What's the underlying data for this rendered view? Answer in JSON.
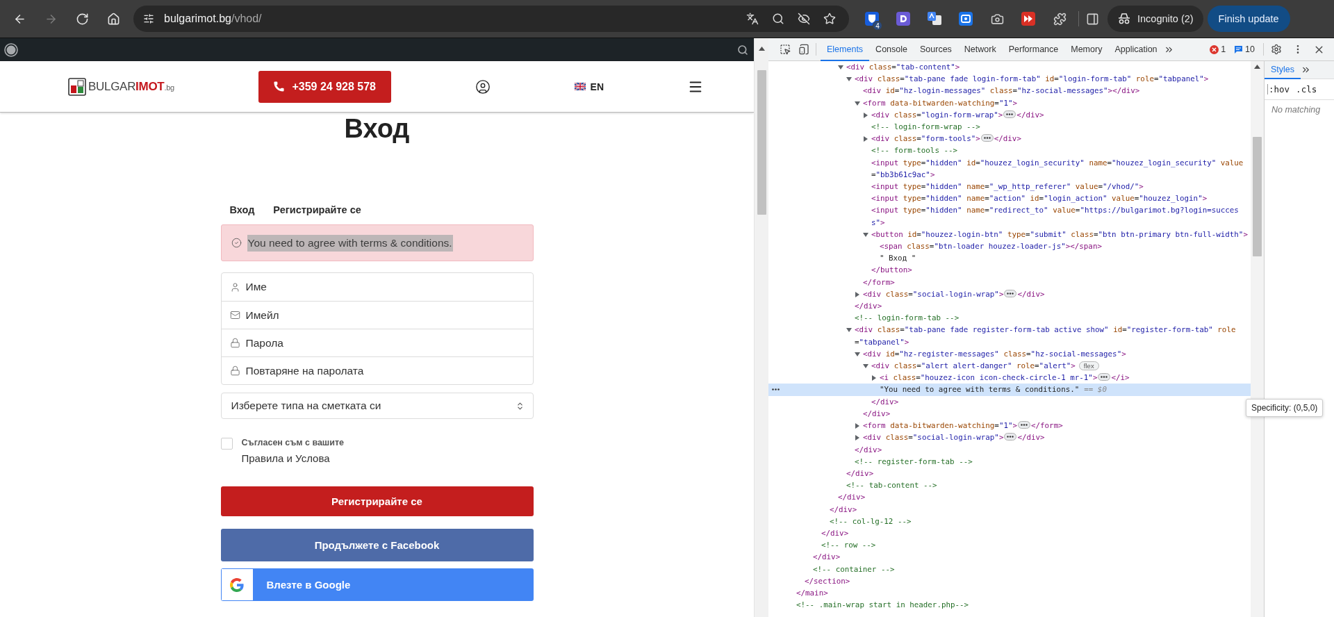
{
  "browser": {
    "forward_disabled": true,
    "url_host": "bulgarimot.bg",
    "url_path": "/vhod/",
    "extension_badge": "4",
    "profile_label": "Incognito (2)",
    "update_button": "Finish update"
  },
  "page": {
    "logo": {
      "light": "BULGAR",
      "bold": "IMOT",
      "suffix": ".bg"
    },
    "phone": "+359 24 928 578",
    "language": "EN",
    "heading": "Вход",
    "tabs": [
      {
        "label": "Вход"
      },
      {
        "label": "Регистрирайте се"
      }
    ],
    "alert": {
      "text": "You need to agree with terms & conditions.",
      "highlighted": true
    },
    "fields": [
      {
        "kind": "person",
        "placeholder": "Име"
      },
      {
        "kind": "mail",
        "placeholder": "Имейл"
      },
      {
        "kind": "lock",
        "placeholder": "Парола"
      },
      {
        "kind": "lock",
        "placeholder": "Повтаряне на паролата"
      }
    ],
    "account_type": {
      "label": "Изберете типа на сметката си"
    },
    "terms": {
      "checked": false,
      "label": "Съгласен съм с вашите",
      "link": "Правила и Услова"
    },
    "buttons": [
      {
        "kind": "primary",
        "label": "Регистрирайте се"
      },
      {
        "kind": "facebook",
        "label": "Продължете с Facebook"
      },
      {
        "kind": "google",
        "label": "Влезте в Google"
      }
    ]
  },
  "devtools": {
    "tabs": [
      {
        "label": "Elements",
        "selected": true
      },
      {
        "label": "Console",
        "selected": false
      },
      {
        "label": "Sources",
        "selected": false
      },
      {
        "label": "Network",
        "selected": false
      },
      {
        "label": "Performance",
        "selected": false
      },
      {
        "label": "Memory",
        "selected": false
      },
      {
        "label": "Application",
        "selected": false
      }
    ],
    "errors": "1",
    "messages": "10",
    "dom_tree": [
      {
        "kind": "element",
        "close": "</main>",
        "selected": false,
        "children": [
          {
            "kind": "element",
            "close": "</section>",
            "selected": false,
            "children": [
              {
                "kind": "element",
                "close": "</div>",
                "selected": false,
                "children": [
                  {
                    "kind": "element",
                    "close": "</div>",
                    "selected": false,
                    "children": [
                      {
                        "kind": "element",
                        "close": "</div>",
                        "selected": false,
                        "children": [
                          {
                            "kind": "element",
                            "close": "</div>",
                            "selected": false,
                            "children": [
                              {
                                "kind": "element",
                                "open": "<div class=\"tab-content\">",
                                "close": "</div>",
                                "expanded": true,
                                "selected": false,
                                "children": [
                                  {
                                    "kind": "element",
                                    "open": "<div class=\"tab-pane fade login-form-tab\" id=\"login-form-tab\" role=\"tabpanel\">",
                                    "close": "</div>",
                                    "expanded": true,
                                    "selected": false,
                                    "children": [
                                      {
                                        "kind": "element",
                                        "open": "<div id=\"hz-login-messages\" class=\"hz-social-messages\"></div>",
                                        "selected": false
                                      },
                                      {
                                        "kind": "element",
                                        "open": "<form data-bitwarden-watching=\"1\">",
                                        "close": "</form>",
                                        "expanded": true,
                                        "selected": false,
                                        "children": [
                                          {
                                            "kind": "element",
                                            "open": "<div class=\"login-form-wrap\">",
                                            "close": "</div>",
                                            "expanded": false,
                                            "selected": false
                                          },
                                          {
                                            "kind": "comment",
                                            "text": "<!-- login-form-wrap -->",
                                            "selected": false
                                          },
                                          {
                                            "kind": "element",
                                            "open": "<div class=\"form-tools\">",
                                            "close": "</div>",
                                            "expanded": false,
                                            "selected": false
                                          },
                                          {
                                            "kind": "comment",
                                            "text": "<!-- form-tools -->",
                                            "selected": false
                                          },
                                          {
                                            "kind": "element",
                                            "open": "<input type=\"hidden\" id=\"houzez_login_security\" name=\"houzez_login_security\" value=\"bb3b61c9ac\">",
                                            "selected": false
                                          },
                                          {
                                            "kind": "element",
                                            "open": "<input type=\"hidden\" name=\"_wp_http_referer\" value=\"/vhod/\">",
                                            "selected": false
                                          },
                                          {
                                            "kind": "element",
                                            "open": "<input type=\"hidden\" name=\"action\" id=\"login_action\" value=\"houzez_login\">",
                                            "selected": false
                                          },
                                          {
                                            "kind": "element",
                                            "open": "<input type=\"hidden\" name=\"redirect_to\" value=\"https://bulgarimot.bg?login=success\">",
                                            "selected": false
                                          },
                                          {
                                            "kind": "element",
                                            "open": "<button id=\"houzez-login-btn\" type=\"submit\" class=\"btn btn-primary btn-full-width\">",
                                            "close": "</button>",
                                            "expanded": true,
                                            "selected": false,
                                            "children": [
                                              {
                                                "kind": "element",
                                                "open": "<span class=\"btn-loader houzez-loader-js\"></span>",
                                                "selected": false
                                              },
                                              {
                                                "kind": "text",
                                                "text": "\" Вход \"",
                                                "selected": false
                                              }
                                            ]
                                          }
                                        ]
                                      },
                                      {
                                        "kind": "element",
                                        "open": "<div class=\"social-login-wrap\">",
                                        "close": "</div>",
                                        "expanded": false,
                                        "selected": false
                                      }
                                    ]
                                  },
                                  {
                                    "kind": "comment",
                                    "text": "<!-- login-form-tab -->",
                                    "selected": false
                                  },
                                  {
                                    "kind": "element",
                                    "open": "<div class=\"tab-pane fade register-form-tab active show\" id=\"register-form-tab\" role=\"tabpanel\">",
                                    "close": "</div>",
                                    "expanded": true,
                                    "selected": false,
                                    "children": [
                                      {
                                        "kind": "element",
                                        "open": "<div id=\"hz-register-messages\" class=\"hz-social-messages\">",
                                        "close": "</div>",
                                        "expanded": true,
                                        "selected": false,
                                        "children": [
                                          {
                                            "kind": "element",
                                            "open": "<div class=\"alert alert-danger\" role=\"alert\">",
                                            "badge": "flex",
                                            "close": "</div>",
                                            "expanded": true,
                                            "selected": false,
                                            "children": [
                                              {
                                                "kind": "element",
                                                "open": "<i class=\"houzez-icon icon-check-circle-1 mr-1\">",
                                                "close": "</i>",
                                                "expanded": false,
                                                "selected": false
                                              },
                                              {
                                                "kind": "text",
                                                "text": "\"You need to agree with terms & conditions.\"",
                                                "console_ref": "== $0",
                                                "selected": true
                                              }
                                            ]
                                          }
                                        ]
                                      },
                                      {
                                        "kind": "element",
                                        "open": "<form data-bitwarden-watching=\"1\">",
                                        "close": "</form>",
                                        "expanded": false,
                                        "selected": false
                                      },
                                      {
                                        "kind": "element",
                                        "open": "<div class=\"social-login-wrap\">",
                                        "close": "</div>",
                                        "expanded": false,
                                        "selected": false
                                      }
                                    ]
                                  },
                                  {
                                    "kind": "comment",
                                    "text": "<!-- register-form-tab -->",
                                    "selected": false
                                  }
                                ]
                              },
                              {
                                "kind": "comment",
                                "text": "<!-- tab-content -->",
                                "selected": false
                              }
                            ]
                          }
                        ]
                      },
                      {
                        "kind": "comment",
                        "text": "<!-- col-lg-12 -->",
                        "selected": false
                      }
                    ]
                  },
                  {
                    "kind": "comment",
                    "text": "<!-- row -->",
                    "selected": false
                  }
                ]
              },
              {
                "kind": "comment",
                "text": "<!-- container -->",
                "selected": false
              }
            ]
          }
        ]
      },
      {
        "kind": "comment",
        "text": "<!-- .main-wrap start in header.php-->",
        "selected": false
      }
    ],
    "styles_tab": "Styles",
    "filter_buttons": [
      ":hov",
      ".cls"
    ],
    "styles_empty": "No matching",
    "tooltip": "Specificity: (0,5,0)"
  }
}
